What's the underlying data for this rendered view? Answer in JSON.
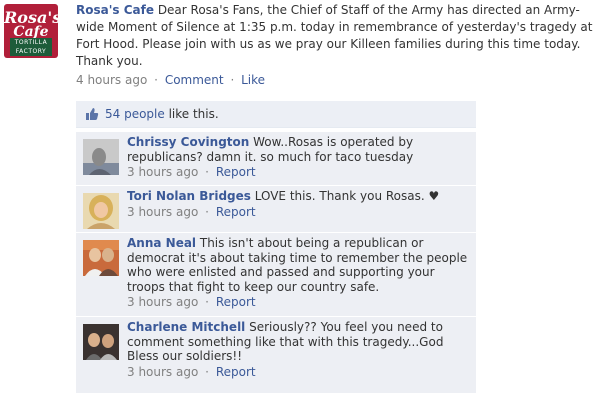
{
  "logo": {
    "line1": "Rosa's",
    "line2": "Cafe",
    "line3": "TORTILLA FACTORY"
  },
  "post": {
    "author": "Rosa's Cafe",
    "text": "Dear Rosa's Fans, the Chief of Staff of the Army has directed an Army-wide Moment of Silence at 1:35 p.m. today in remembrance of yesterday's tragedy at Fort Hood. Please join with us as we pray our Killeen families during this time today. Thank you.",
    "time": "4 hours ago",
    "comment_label": "Comment",
    "like_label": "Like",
    "separator": "·"
  },
  "likes": {
    "count_text": "54 people",
    "suffix": "like this."
  },
  "comments": [
    {
      "name": "Chrissy Covington",
      "text": "Wow..Rosas is operated by republicans? damn it. so much for taco tuesday",
      "time": "3 hours ago",
      "report": "Report"
    },
    {
      "name": "Tori Nolan Bridges",
      "text": "LOVE this. Thank you Rosas. ♥",
      "time": "3 hours ago",
      "report": "Report"
    },
    {
      "name": "Anna Neal",
      "text": "This isn't about being a republican or democrat it's about taking time to remember the people who were enlisted and passed and supporting your troops that fight to keep our country safe.",
      "time": "3 hours ago",
      "report": "Report"
    },
    {
      "name": "Charlene Mitchell",
      "text": "Seriously?? You feel you need to comment something like that with this tragedy...God Bless our soldiers!!",
      "time": "3 hours ago",
      "report": "Report"
    }
  ],
  "colors": {
    "link": "#3b5998",
    "comment_bg": "#edeff4",
    "meta": "#808080"
  }
}
